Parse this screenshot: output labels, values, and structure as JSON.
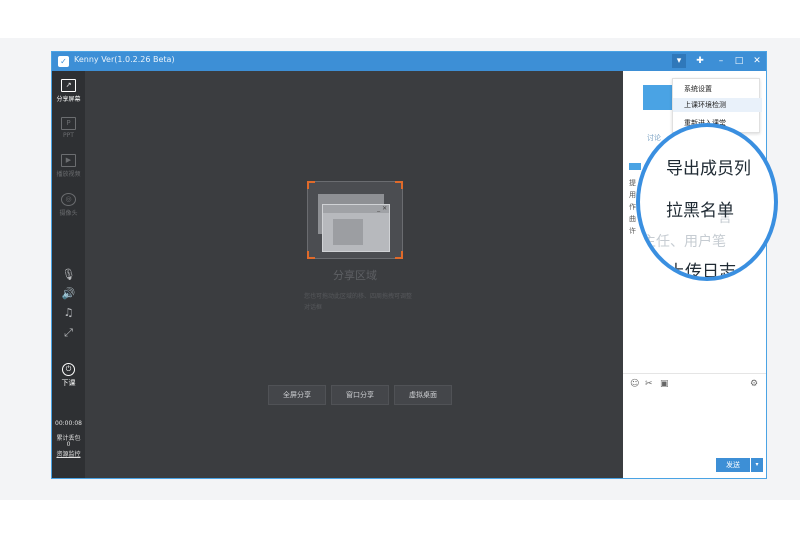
{
  "app": {
    "title": "Kenny Ver(1.0.2.26 Beta)"
  },
  "titlebar": {
    "controls": [
      "menu-dropdown",
      "pin",
      "minimize",
      "maximize",
      "close"
    ]
  },
  "sidebar": {
    "items": [
      {
        "label": "分享屏幕",
        "icon": "share-screen-icon",
        "active": true
      },
      {
        "label": "PPT",
        "icon": "ppt-icon",
        "active": false
      },
      {
        "label": "播放视频",
        "icon": "video-icon",
        "active": false
      },
      {
        "label": "摄像头",
        "icon": "camera-icon",
        "active": false
      }
    ],
    "audio_icons": [
      "microphone-icon",
      "speaker-icon",
      "music-icon",
      "fullscreen-icon"
    ],
    "end_class": {
      "label": "下课",
      "icon": "power-icon"
    },
    "timer": "00:00:08",
    "stats_label": "累计丢包",
    "stats_value": "0",
    "monitor_link": "资源监控"
  },
  "share_area": {
    "title": "分享区域",
    "description": "您也可拖动此区域的移、四周拖拽可调整对话框",
    "buttons": [
      "全屏分享",
      "窗口分享",
      "虚拟桌面"
    ]
  },
  "right_panel": {
    "tab_label": "讨论",
    "chat_lines": [
      "提",
      "用",
      "作",
      "曲",
      "许"
    ],
    "toolbar_icons": [
      "emoji-icon",
      "scissors-icon",
      "image-icon",
      "settings-icon"
    ],
    "send_label": "发送"
  },
  "dropdown_menu": {
    "items": [
      "系统设置",
      "上课环境检测",
      "重新进入课堂"
    ],
    "highlighted_index": 1
  },
  "magnifier": {
    "items": [
      "导出成员列",
      "拉黑名单",
      "上传日志"
    ],
    "ghost_text": [
      "言",
      "主任、用户笔"
    ]
  },
  "colors": {
    "accent": "#3d8fd6",
    "window_bg": "#3b3d40",
    "sidebar_bg": "#2e3033",
    "highlight": "#3a8fe0"
  }
}
